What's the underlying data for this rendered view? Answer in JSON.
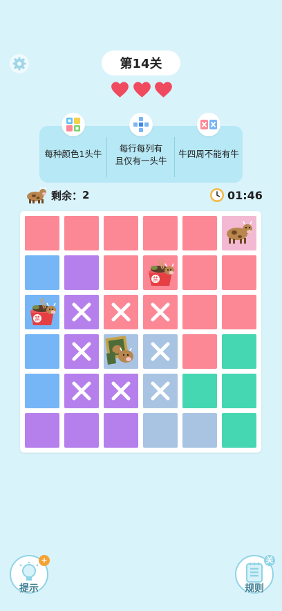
{
  "header": {
    "level_title": "第14关",
    "lives": 3
  },
  "rules": [
    {
      "icon": "color-grid-icon",
      "text": "每种颜色1头牛"
    },
    {
      "icon": "cross-grid-icon",
      "text": "每行每列有\n且仅有一头牛"
    },
    {
      "icon": "no-adjacent-icon",
      "text": "牛四周不能有牛"
    }
  ],
  "status": {
    "remaining_label": "剩余：",
    "remaining_value": "2",
    "timer": "01:46"
  },
  "colors": {
    "pink": "#fc8896",
    "purple": "#b680ec",
    "blue": "#76b6f6",
    "lightblue": "#a8c4e2",
    "green": "#45d6b2",
    "lightpink": "#f3b9d3"
  },
  "board": {
    "rows": [
      [
        "pink",
        "pink",
        "pink",
        "pink",
        "pink",
        "lightpink"
      ],
      [
        "blue",
        "purple",
        "pink",
        "pink",
        "pink",
        "pink"
      ],
      [
        "blue",
        "purple",
        "pink",
        "pink",
        "pink",
        "pink"
      ],
      [
        "blue",
        "purple",
        "lightblue",
        "lightblue",
        "pink",
        "green"
      ],
      [
        "blue",
        "purple",
        "purple",
        "lightblue",
        "green",
        "green"
      ],
      [
        "purple",
        "purple",
        "purple",
        "lightblue",
        "lightblue",
        "green"
      ]
    ],
    "marks": [
      [
        "",
        "",
        "",
        "",
        "",
        "cow-hint"
      ],
      [
        "",
        "",
        "",
        "cow-bowl",
        "",
        ""
      ],
      [
        "cow-bowl",
        "x",
        "x",
        "x",
        "",
        ""
      ],
      [
        "",
        "x",
        "cow-frame",
        "x",
        "",
        ""
      ],
      [
        "",
        "x",
        "x",
        "x",
        "",
        ""
      ],
      [
        "",
        "",
        "",
        "",
        "",
        ""
      ]
    ]
  },
  "buttons": {
    "hint_label": "提示",
    "hint_badge": "+",
    "rules_label": "规则",
    "rules_badge": "关"
  }
}
